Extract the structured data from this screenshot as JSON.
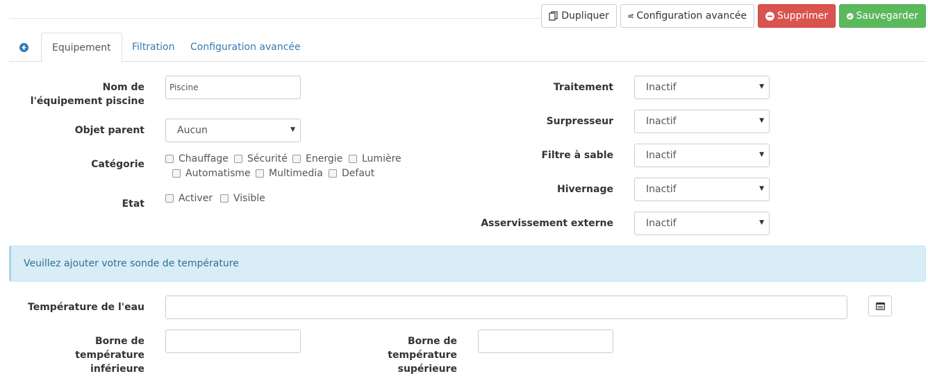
{
  "toolbar": {
    "duplicate_label": "Dupliquer",
    "advanced_config_label": "Configuration avancée",
    "delete_label": "Supprimer",
    "save_label": "Sauvegarder",
    "delete_color": "#d9534f",
    "save_color": "#5cb85c"
  },
  "tabs": [
    {
      "label": "Equipement",
      "active": true
    },
    {
      "label": "Filtration",
      "active": false
    },
    {
      "label": "Configuration avancée",
      "active": false
    }
  ],
  "form": {
    "name_label": "Nom de l'équipement piscine",
    "name_value": "Piscine",
    "parent_label": "Objet parent",
    "parent_value": "Aucun",
    "category_label": "Catégorie",
    "categories": [
      "Chauffage",
      "Sécurité",
      "Energie",
      "Lumière",
      "Automatisme",
      "Multimedia",
      "Defaut"
    ],
    "state_label": "Etat",
    "states": [
      "Activer",
      "Visible"
    ]
  },
  "options": [
    {
      "label": "Traitement",
      "value": "Inactif"
    },
    {
      "label": "Surpresseur",
      "value": "Inactif"
    },
    {
      "label": "Filtre à sable",
      "value": "Inactif"
    },
    {
      "label": "Hivernage",
      "value": "Inactif"
    },
    {
      "label": "Asservissement externe",
      "value": "Inactif"
    }
  ],
  "alert": {
    "text": "Veuillez ajouter votre sonde de température",
    "color": "#d9edf7"
  },
  "temperature": {
    "water_label": "Température de l'eau",
    "water_value": "",
    "lower_label": "Borne de température inférieure",
    "lower_value": "",
    "upper_label": "Borne de température supérieure",
    "upper_value": ""
  }
}
